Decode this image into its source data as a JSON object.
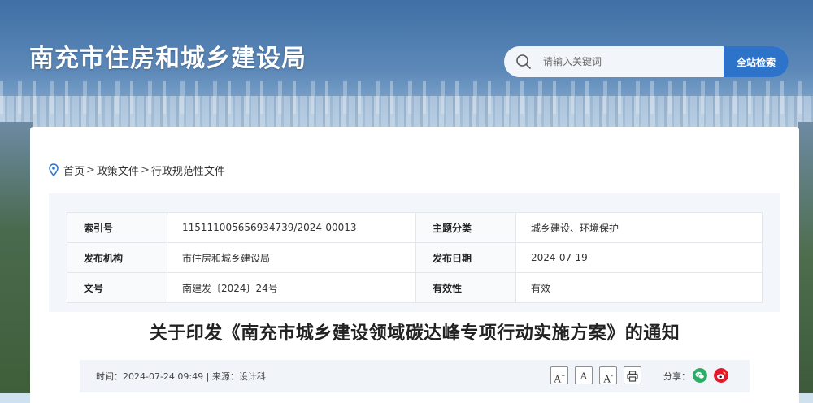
{
  "header": {
    "site_title": "南充市住房和城乡建设局",
    "search": {
      "placeholder": "请输入关键词",
      "button_label": "全站检索"
    }
  },
  "breadcrumb": {
    "items": [
      "首页",
      "政策文件",
      "行政规范性文件"
    ],
    "separator": ">"
  },
  "meta_table": {
    "rows": [
      {
        "k1": "索引号",
        "v1": "115111005656934739/2024-00013",
        "k2": "主题分类",
        "v2": "城乡建设、环境保护"
      },
      {
        "k1": "发布机构",
        "v1": "市住房和城乡建设局",
        "k2": "发布日期",
        "v2": "2024-07-19"
      },
      {
        "k1": "文号",
        "v1": "南建发〔2024〕24号",
        "k2": "有效性",
        "v2": "有效"
      }
    ]
  },
  "document": {
    "title": "关于印发《南充市城乡建设领域碳达峰专项行动实施方案》的通知",
    "info": "时间：2024-07-24 09:49 | 来源：设计科"
  },
  "tools": {
    "font_large": "A",
    "font_medium": "A",
    "font_small": "A",
    "share_label": "分享："
  },
  "colors": {
    "accent": "#2d73c9",
    "wechat": "#2aae67",
    "weibo": "#e6162d"
  },
  "icons": [
    "search-icon",
    "location-pin-icon",
    "print-icon",
    "wechat-icon",
    "weibo-icon"
  ]
}
